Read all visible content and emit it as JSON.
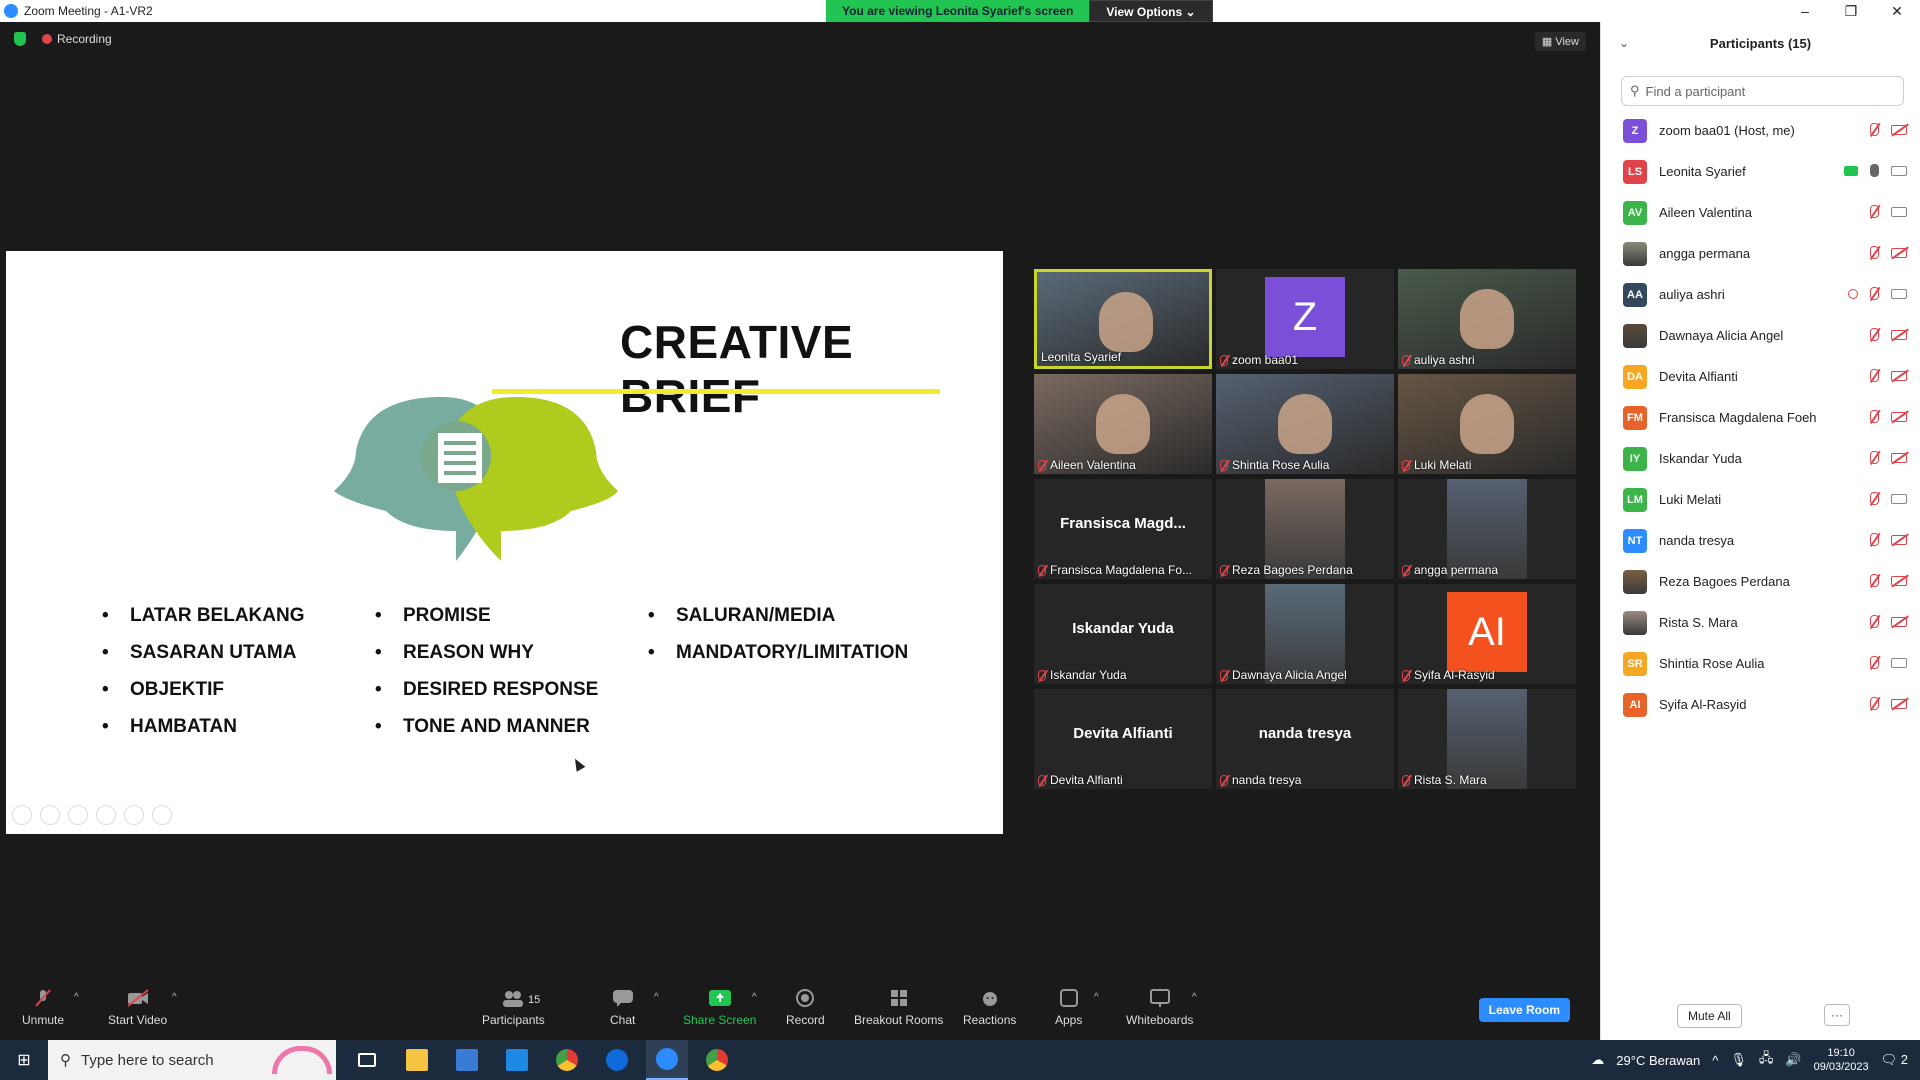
{
  "window": {
    "title": "Zoom Meeting - A1-VR2",
    "viewing_banner": "You are viewing Leonita Syarief's screen",
    "view_options": "View Options"
  },
  "status": {
    "recording": "Recording",
    "view": "View"
  },
  "slide": {
    "title": "CREATIVE BRIEF",
    "col1": [
      "LATAR BELAKANG",
      "SASARAN UTAMA",
      "OBJEKTIF",
      "HAMBATAN"
    ],
    "col2": [
      "PROMISE",
      "REASON WHY",
      "DESIRED RESPONSE",
      "TONE AND MANNER"
    ],
    "col3": [
      "SALURAN/MEDIA",
      "MANDATORY/LIMITATION"
    ]
  },
  "tiles": [
    {
      "name": "Leonita Syarief",
      "kind": "video",
      "active": true
    },
    {
      "name": "zoom baa01",
      "kind": "avatar",
      "letter": "Z",
      "color": "#7b4fd8"
    },
    {
      "name": "auliya ashri",
      "kind": "video"
    },
    {
      "name": "Aileen Valentina",
      "kind": "video"
    },
    {
      "name": "Shintia Rose Aulia",
      "kind": "video"
    },
    {
      "name": "Luki Melati",
      "kind": "video"
    },
    {
      "name": "Fransisca Magdalena Fo...",
      "kind": "text",
      "big": "Fransisca  Magd..."
    },
    {
      "name": "Reza Bagoes Perdana",
      "kind": "photo"
    },
    {
      "name": "angga permana",
      "kind": "photo"
    },
    {
      "name": "Iskandar Yuda",
      "kind": "text",
      "big": "Iskandar Yuda"
    },
    {
      "name": "Dawnaya Alicia Angel",
      "kind": "photo"
    },
    {
      "name": "Syifa Al-Rasyid",
      "kind": "avatar",
      "letter": "AI",
      "color": "#f4511e"
    },
    {
      "name": "Devita Alfianti",
      "kind": "text",
      "big": "Devita Alfianti"
    },
    {
      "name": "nanda tresya",
      "kind": "text",
      "big": "nanda tresya"
    },
    {
      "name": "Rista S. Mara",
      "kind": "photo"
    }
  ],
  "toolbar": {
    "unmute": "Unmute",
    "start_video": "Start Video",
    "participants": "Participants",
    "participants_count": "15",
    "chat": "Chat",
    "share": "Share Screen",
    "record": "Record",
    "breakout": "Breakout Rooms",
    "reactions": "Reactions",
    "apps": "Apps",
    "whiteboards": "Whiteboards",
    "leave": "Leave Room"
  },
  "panel": {
    "title": "Participants (15)",
    "search_placeholder": "Find a participant",
    "mute_all": "Mute All",
    "more": "···",
    "participants": [
      {
        "initials": "Z",
        "name": "zoom baa01 (Host, me)",
        "color": "#7b4fd8",
        "mic": "muted",
        "cam": "off"
      },
      {
        "initials": "LS",
        "name": "Leonita Syarief",
        "color": "#e0444a",
        "mic": "live",
        "cam": "on",
        "sharing": true
      },
      {
        "initials": "AV",
        "name": "Aileen Valentina",
        "color": "#3bb54a",
        "mic": "muted",
        "cam": "on"
      },
      {
        "initials": "",
        "name": "angga permana",
        "color": "#8a8a7a",
        "mic": "muted",
        "cam": "off",
        "photo": true
      },
      {
        "initials": "AA",
        "name": "auliya ashri",
        "color": "#34495e",
        "mic": "muted",
        "cam": "on",
        "rec": true
      },
      {
        "initials": "",
        "name": "Dawnaya Alicia Angel",
        "color": "#5a4a3a",
        "mic": "muted",
        "cam": "off",
        "photo": true
      },
      {
        "initials": "DA",
        "name": "Devita Alfianti",
        "color": "#f5a623",
        "mic": "muted",
        "cam": "off"
      },
      {
        "initials": "FM",
        "name": "Fransisca Magdalena Foeh",
        "color": "#e8632a",
        "mic": "muted",
        "cam": "off"
      },
      {
        "initials": "IY",
        "name": "Iskandar Yuda",
        "color": "#3bb54a",
        "mic": "muted",
        "cam": "off"
      },
      {
        "initials": "LM",
        "name": "Luki Melati",
        "color": "#3bb54a",
        "mic": "muted",
        "cam": "on"
      },
      {
        "initials": "NT",
        "name": "nanda tresya",
        "color": "#2d8cff",
        "mic": "muted",
        "cam": "off"
      },
      {
        "initials": "",
        "name": "Reza Bagoes Perdana",
        "color": "#7a6045",
        "mic": "muted",
        "cam": "off",
        "photo": true
      },
      {
        "initials": "",
        "name": "Rista S. Mara",
        "color": "#9a8a80",
        "mic": "muted",
        "cam": "off",
        "photo": true
      },
      {
        "initials": "SR",
        "name": "Shintia Rose Aulia",
        "color": "#f5a623",
        "mic": "muted",
        "cam": "on"
      },
      {
        "initials": "AI",
        "name": "Syifa Al-Rasyid",
        "color": "#e8632a",
        "mic": "muted",
        "cam": "off"
      }
    ]
  },
  "taskbar": {
    "search_placeholder": "Type here to search",
    "weather": "29°C  Berawan",
    "time": "19:10",
    "date": "09/03/2023",
    "notif_count": "2"
  }
}
